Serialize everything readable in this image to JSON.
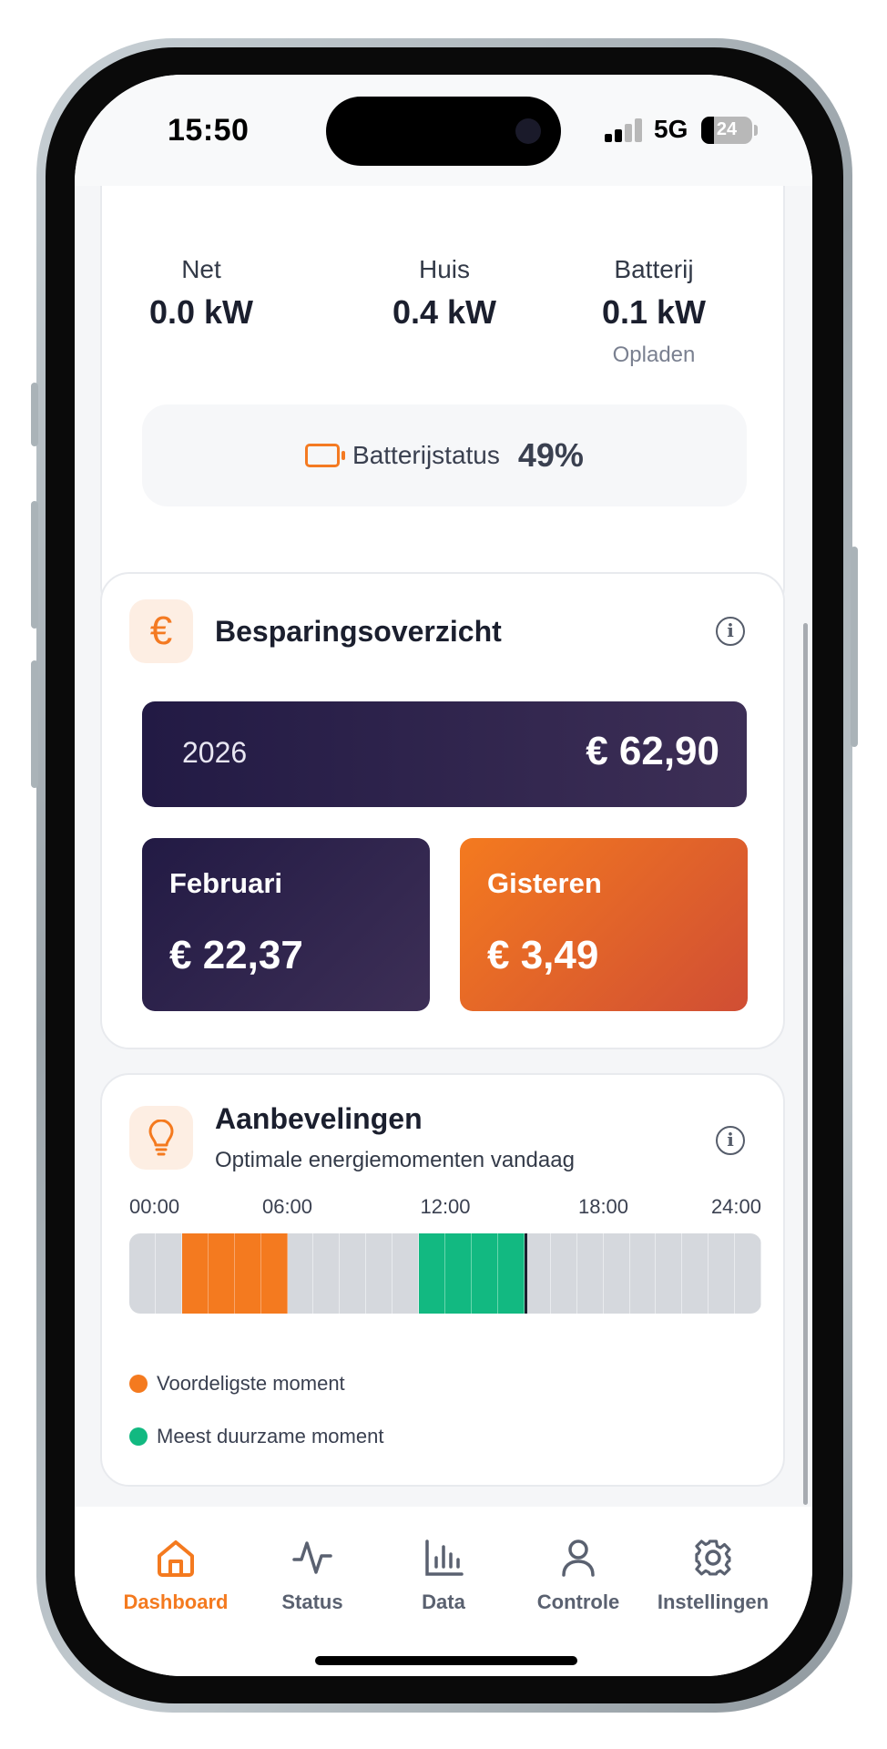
{
  "status_bar": {
    "time": "15:50",
    "network": "5G",
    "battery": "24"
  },
  "energy": {
    "grid": {
      "label": "Net",
      "value": "0.0 kW"
    },
    "house": {
      "label": "Huis",
      "value": "0.4 kW"
    },
    "battery": {
      "label": "Batterij",
      "value": "0.1 kW",
      "sub": "Opladen"
    },
    "battery_status": {
      "label": "Batterijstatus",
      "value": "49%"
    }
  },
  "savings": {
    "title": "Besparingsoverzicht",
    "year": {
      "label": "2026",
      "amount": "€ 62,90"
    },
    "month": {
      "label": "Februari",
      "amount": "€ 22,37"
    },
    "yesterday": {
      "label": "Gisteren",
      "amount": "€ 3,49"
    }
  },
  "recommendations": {
    "title": "Aanbevelingen",
    "subtitle": "Optimale energiemomenten vandaag",
    "time_labels": [
      "00:00",
      "06:00",
      "12:00",
      "18:00",
      "24:00"
    ],
    "slot_hours": 1,
    "cheapest_hours": [
      2,
      3,
      4,
      5
    ],
    "greenest_hours": [
      11,
      12,
      13,
      14
    ],
    "current_hour": 15,
    "legend": {
      "cheapest": "Voordeligste moment",
      "greenest": "Meest duurzame moment"
    }
  },
  "nav": {
    "items": [
      {
        "label": "Dashboard",
        "icon": "home-icon",
        "active": true
      },
      {
        "label": "Status",
        "icon": "activity-icon",
        "active": false
      },
      {
        "label": "Data",
        "icon": "bar-chart-icon",
        "active": false
      },
      {
        "label": "Controle",
        "icon": "user-icon",
        "active": false
      },
      {
        "label": "Instellingen",
        "icon": "gear-icon",
        "active": false
      }
    ]
  },
  "colors": {
    "accent": "#f47a1f",
    "dark": "#221a44",
    "green": "#12b981"
  }
}
